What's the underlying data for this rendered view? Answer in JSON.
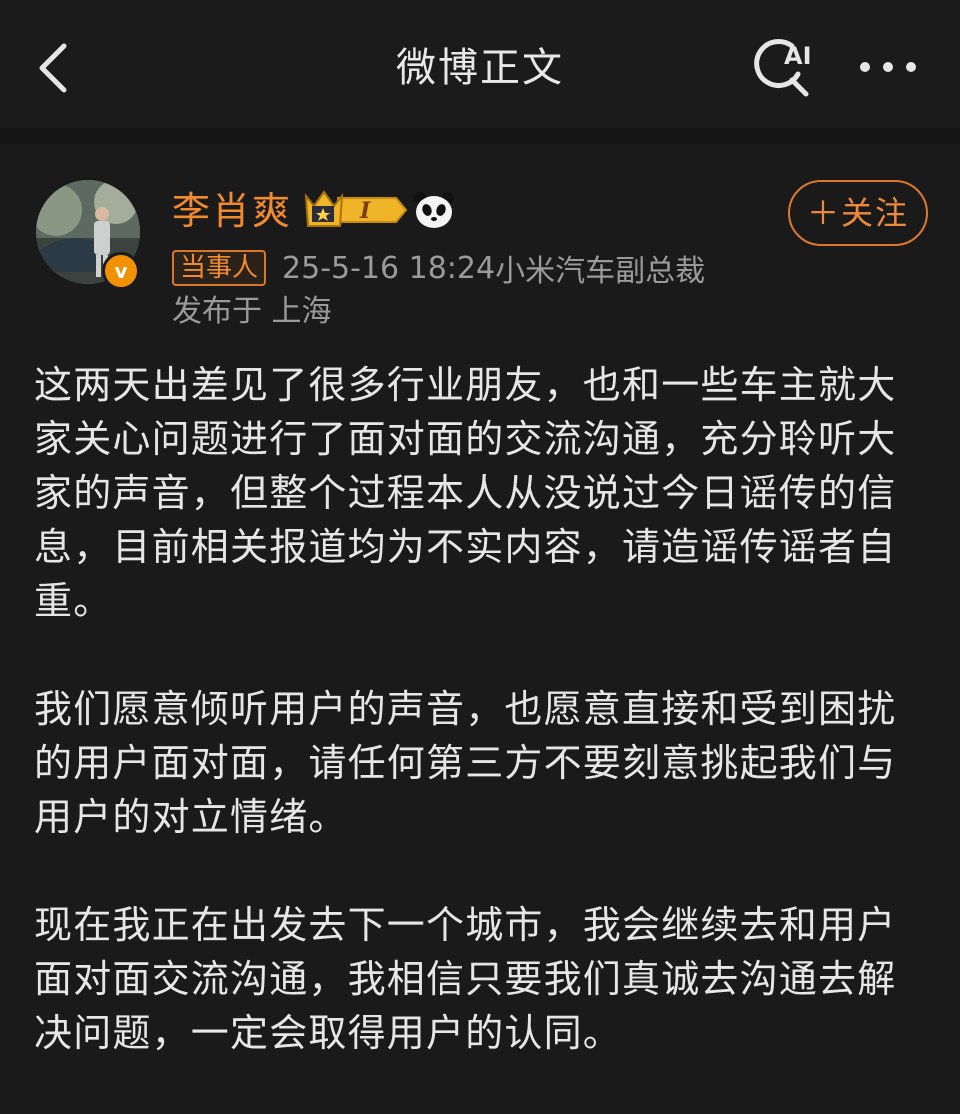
{
  "nav": {
    "title": "微博正文",
    "back_icon": "chevron-left-icon",
    "ai_search_icon": "ai-search-icon",
    "ai_label": "AI",
    "more_icon": "more-dots-icon"
  },
  "post": {
    "author": {
      "name": "李肖爽",
      "avatar": "avatar",
      "verified_icon": "verified-badge-icon",
      "verified_glyph": "v",
      "crown_badge_icon": "crown-level-badge-icon",
      "level_label": "I",
      "panda_icon": "panda-icon"
    },
    "follow_label": "＋关注",
    "tag": "当事人",
    "datetime": "25-5-16 18:24",
    "source": "小米汽车副总裁",
    "location": "发布于 上海",
    "paragraphs": [
      "这两天出差见了很多行业朋友，也和一些车主就大家关心问题进行了面对面的交流沟通，充分聆听大家的声音，但整个过程本人从没说过今日谣传的信息，目前相关报道均为不实内容，请造谣传谣者自重。",
      "我们愿意倾听用户的声音，也愿意直接和受到困扰的用户面对面，请任何第三方不要刻意挑起我们与用户的对立情绪。",
      "现在我正在出发去下一个城市，我会继续去和用户面对面交流沟通，我相信只要我们真诚去沟通去解决问题，一定会取得用户的认同。"
    ]
  },
  "colors": {
    "background": "#1a1a1a",
    "accent": "#f28a2e",
    "text": "#e6e6e6",
    "secondary_text": "#9a9a9a"
  }
}
